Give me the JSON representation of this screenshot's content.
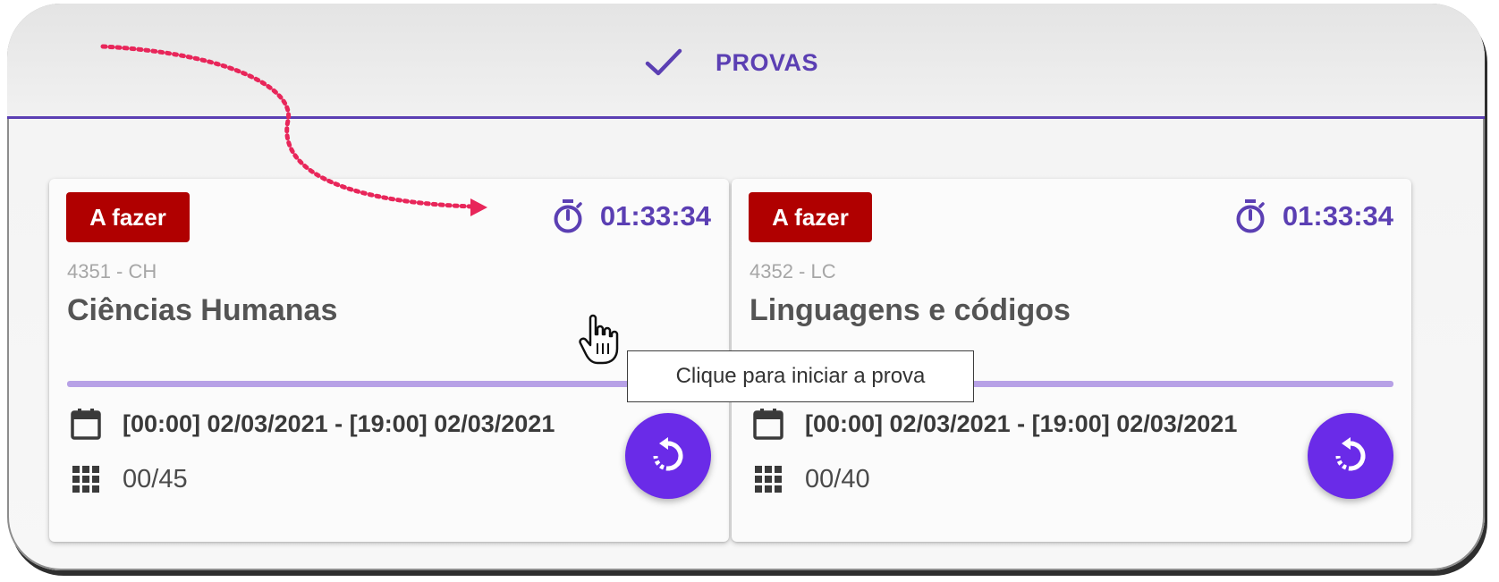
{
  "header": {
    "tab_label": "PROVAS",
    "tab_icon": "check-icon"
  },
  "cards": [
    {
      "status": "A fazer",
      "timer": "01:33:34",
      "code": "4351 - CH",
      "title": "Ciências Humanas",
      "period": "[00:00] 02/03/2021 - [19:00] 02/03/2021",
      "count": "00/45"
    },
    {
      "status": "A fazer",
      "timer": "01:33:34",
      "code": "4352 - LC",
      "title": "Linguagens e códigos",
      "period": "[00:00] 02/03/2021 - [19:00] 02/03/2021",
      "count": "00/40"
    }
  ],
  "tooltip": "Clique para iniciar a prova",
  "colors": {
    "accent": "#5b3fb3",
    "badge": "#b00000",
    "fab": "#6a2be8",
    "progress": "#b7a1e6",
    "arrow": "#e8265a"
  }
}
